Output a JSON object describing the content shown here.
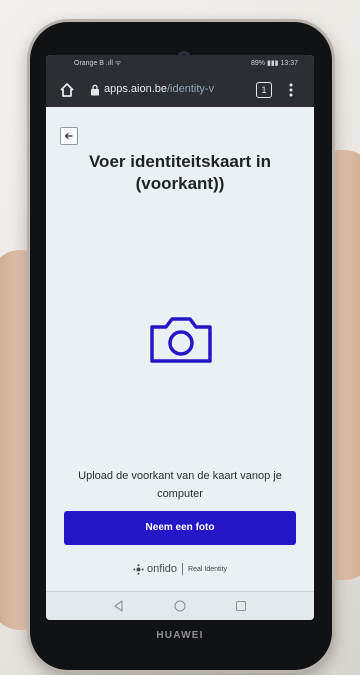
{
  "status_bar": {
    "left": "Orange B .ıll ᯤ",
    "right": "89% ▮▮▮ 13:37"
  },
  "browser": {
    "domain": "apps.aion.be",
    "path": "/identity-v",
    "tab_count": "1"
  },
  "page": {
    "title": "Voer identiteitskaart in (voorkant))",
    "instructions": "Upload de voorkant van de kaart vanop je computer",
    "take_photo_label": "Neem een foto"
  },
  "footer": {
    "logo_text": "onfido",
    "tagline": "Real Identity"
  },
  "device": {
    "brand": "HUAWEI"
  },
  "colors": {
    "accent": "#2517c8",
    "camera_icon": "#2517c8",
    "screen_background": "#e9f1f4",
    "browser_bar": "#2b2f33"
  },
  "icons": {
    "home": "home-icon",
    "lock": "lock-icon",
    "tabs": "tabs-icon",
    "menu": "more-vertical-icon",
    "back": "arrow-left-icon",
    "camera": "camera-icon"
  }
}
